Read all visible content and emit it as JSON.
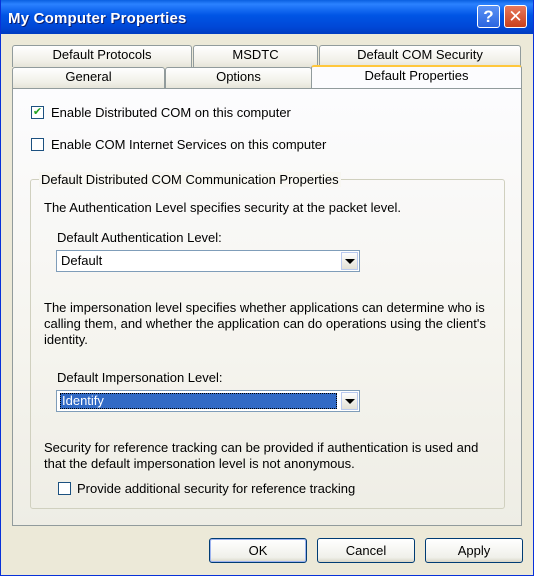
{
  "window": {
    "title": "My Computer Properties"
  },
  "tabs": {
    "row1": [
      "Default Protocols",
      "MSDTC",
      "Default COM Security"
    ],
    "row2": [
      "General",
      "Options",
      "Default Properties"
    ],
    "active": "Default Properties"
  },
  "options": {
    "enable_dcom": {
      "label": "Enable Distributed COM on this computer",
      "checked": true
    },
    "enable_cis": {
      "label": "Enable COM Internet Services on this computer",
      "checked": false
    }
  },
  "group": {
    "title": "Default Distributed COM Communication Properties",
    "auth_desc": "The Authentication Level specifies security at the packet level.",
    "auth_label": "Default Authentication Level:",
    "auth_value": "Default",
    "imp_desc": "The impersonation level specifies whether applications can determine who is calling them, and whether the application can do operations using the client's identity.",
    "imp_label": "Default Impersonation Level:",
    "imp_value": "Identify",
    "ref_desc": "Security for reference tracking can be provided if authentication is used and that the default impersonation level is not anonymous.",
    "ref_checkbox": {
      "label": "Provide additional security for reference tracking",
      "checked": false
    }
  },
  "buttons": {
    "ok": "OK",
    "cancel": "Cancel",
    "apply": "Apply"
  },
  "icons": {
    "help": "question-mark-icon",
    "close": "close-x-icon",
    "check": "checkmark-icon",
    "dropdown": "chevron-down-icon"
  },
  "colors": {
    "titlebar": "#0054e3",
    "active_tab_accent": "#ffc73c",
    "selection": "#316ac5"
  }
}
